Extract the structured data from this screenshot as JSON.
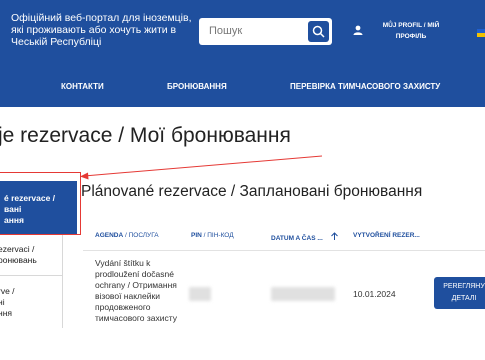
{
  "header": {
    "portal_title": "Офіційний веб-портал для іноземців, які проживають або хочуть жити в Чеській Республіці",
    "search_placeholder": "Пошук",
    "profile_line1": "MŮJ PROFIL / МІЙ",
    "profile_line2": "ПРОФІЛЬ",
    "accent_color": "#1f4f9e"
  },
  "nav": {
    "items": [
      "КОНТАКТИ",
      "БРОНЮВАННЯ",
      "ПЕРЕВІРКА ТИМЧАСОВОГО ЗАХИСТУ"
    ]
  },
  "page": {
    "title": "je rezervace / Мої бронювання"
  },
  "sidebar": {
    "active_line1": "é rezervace /",
    "active_line2": "вані",
    "active_line3": "ання",
    "item2_line1": "ezervaci /",
    "item2_line2": "ронювань",
    "item3_line1": "rve /",
    "item3_line2": "ні",
    "item3_line3": "ння"
  },
  "section": {
    "title": "Plánované rezervace / Заплановані бронювання"
  },
  "table": {
    "col_agenda_bold": "AGENDA",
    "col_agenda_rest": " / ПОСЛУГА",
    "col_pin_bold": "PIN",
    "col_pin_rest": " / ПІН-КОД",
    "col_date_bold": "DATUM A ČAS ...",
    "col_created_bold": "VYTVOŘENÍ REZER...",
    "row": {
      "agenda": "Vydání štítku k prodloužení dočasné ochrany / Отримання візової наклейки продовженого тимчасового захисту",
      "created": "10.01.2024",
      "detail_line1": "PEREГЛЯНУ",
      "detail_line2": "ДЕТАЛІ"
    }
  },
  "colors": {
    "annotation": "#e53935",
    "flag_top": "#1f5fd0",
    "flag_bottom": "#f2c200"
  }
}
